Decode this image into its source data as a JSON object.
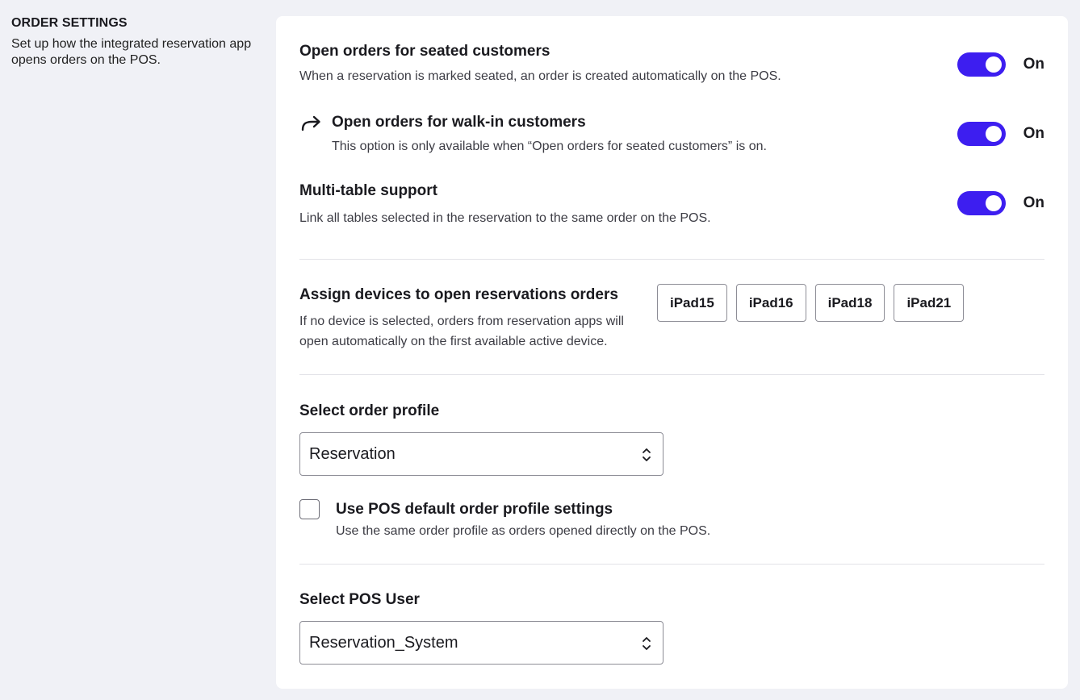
{
  "sidebar": {
    "title": "ORDER SETTINGS",
    "description": "Set up how the integrated reservation app opens orders on the POS."
  },
  "seated": {
    "title": "Open orders for seated customers",
    "description": "When a reservation is marked seated, an order is created automatically on the POS.",
    "toggle_label": "On",
    "enabled": true
  },
  "walkin": {
    "title": "Open orders for walk-in customers",
    "description": "This option is only available when “Open orders for seated customers” is on.",
    "toggle_label": "On",
    "enabled": true,
    "icon": "arrow-turn-right-icon"
  },
  "multitable": {
    "title": "Multi-table support",
    "description": "Link all tables selected in the reservation to the same order on the POS.",
    "toggle_label": "On",
    "enabled": true
  },
  "devices": {
    "title": "Assign devices to open reservations orders",
    "description": "If no device is selected, orders from reservation apps will open automatically on the first available active device.",
    "items": [
      "iPad15",
      "iPad16",
      "iPad18",
      "iPad21"
    ]
  },
  "order_profile": {
    "label": "Select order profile",
    "value": "Reservation",
    "checkbox_title": "Use POS default order profile settings",
    "checkbox_description": "Use the same order profile as orders opened directly on the POS.",
    "checked": false
  },
  "pos_user": {
    "label": "Select POS User",
    "value": "Reservation_System"
  },
  "colors": {
    "accent": "#3d1ef0",
    "background": "#f0f1f6",
    "card": "#ffffff"
  }
}
